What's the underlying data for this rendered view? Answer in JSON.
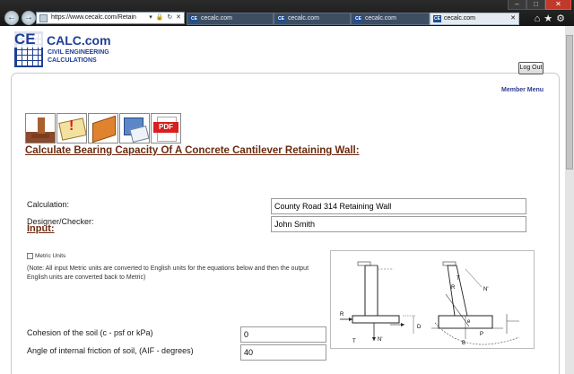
{
  "browser": {
    "url": "https://www.cecalc.com/Retain",
    "tabs": [
      {
        "label": "cecalc.com",
        "active": false
      },
      {
        "label": "cecalc.com",
        "active": false
      },
      {
        "label": "cecalc.com",
        "active": false
      },
      {
        "label": "cecalc.com",
        "active": true
      }
    ],
    "icons": [
      "back-icon",
      "forward-icon",
      "home-icon",
      "star-icon",
      "gear-icon"
    ]
  },
  "logo": {
    "ce": "CE",
    "calc": "CALC.com",
    "line1": "CIVIL ENGINEERING",
    "line2": "CALCULATIONS"
  },
  "header": {
    "logout_label": "Log Out",
    "member_menu": "Member Menu"
  },
  "toolbar_icons": [
    "retaining-wall-icon",
    "mail-alert-icon",
    "book-icon",
    "calculator-icon",
    "pdf-icon"
  ],
  "toolbar_pdf_label": "PDF",
  "page_title": "Calculate Bearing Capacity Of A Concrete Cantilever Retaining Wall:",
  "project": {
    "calculation_label": "Calculation:",
    "calculation_value": "County Road 314 Retaining Wall",
    "designer_label": "Designer/Checker:",
    "designer_value": "John Smith"
  },
  "input": {
    "section_title": "Input:",
    "metric_label": "Metric Units",
    "note": "(Note: All input Metric units are converted to English units for the equations below and then the output English units are converted back to Metric)",
    "cohesion_label": "Cohesion of the soil (c - psf or kPa)",
    "cohesion_value": "0",
    "friction_label": "Angle of internal friction of soil, (AIF - degrees)",
    "friction_value": "40"
  },
  "diagram_labels": {
    "r": "R",
    "t": "T",
    "n": "N'",
    "d": "D",
    "b": "B",
    "e": "e",
    "p": "P"
  },
  "colors": {
    "brand_blue": "#1f3f95",
    "title_brown": "#6b2a0e",
    "member_link": "#2e3b8f"
  }
}
